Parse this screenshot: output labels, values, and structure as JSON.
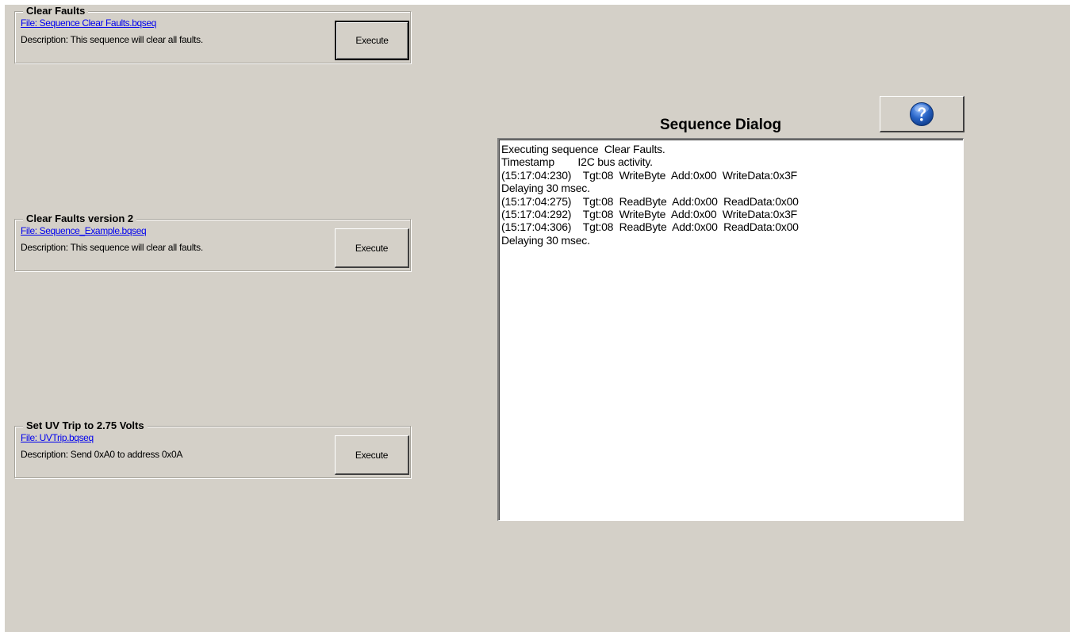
{
  "sequences": [
    {
      "title": "Clear Faults",
      "file": "File: Sequence Clear Faults.bqseq",
      "description": "Description:  This sequence will clear all faults.",
      "button": "Execute"
    },
    {
      "title": "Clear Faults version 2",
      "file": "File: Sequence_Example.bqseq",
      "description": "Description:  This sequence will clear all faults.",
      "button": "Execute"
    },
    {
      "title": "Set UV Trip to 2.75 Volts",
      "file": "File: UVTrip.bqseq",
      "description": "Description:  Send 0xA0 to address 0x0A",
      "button": "Execute"
    }
  ],
  "dialog": {
    "title": "Sequence Dialog",
    "help_icon": "question-mark-icon",
    "log": [
      "Executing sequence  Clear Faults.",
      "Timestamp        I2C bus activity.",
      "(15:17:04:230)    Tgt:08  WriteByte  Add:0x00  WriteData:0x3F",
      "Delaying 30 msec.",
      "(15:17:04:275)    Tgt:08  ReadByte  Add:0x00  ReadData:0x00",
      "(15:17:04:292)    Tgt:08  WriteByte  Add:0x00  WriteData:0x3F",
      "(15:17:04:306)    Tgt:08  ReadByte  Add:0x00  ReadData:0x00",
      "Delaying 30 msec."
    ]
  },
  "colors": {
    "panel_bg": "#d4d0c8",
    "link": "#0000ee",
    "help_icon_blue": "#2a66c8"
  }
}
